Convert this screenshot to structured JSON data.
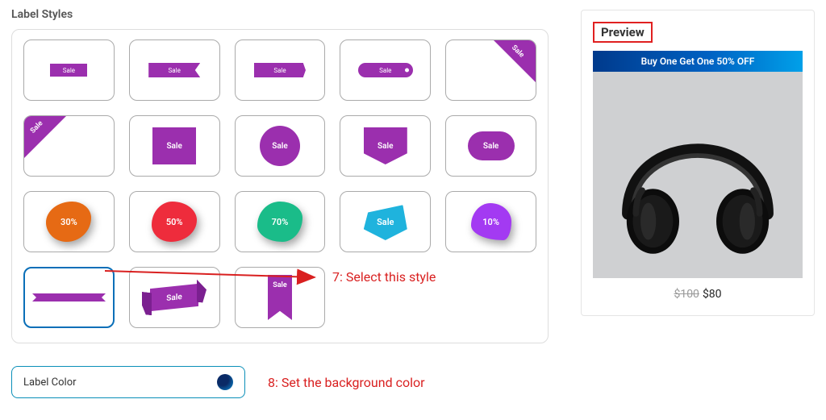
{
  "section_title": "Label Styles",
  "sale_text": "Sale",
  "blob_labels": {
    "b1": "30%",
    "b2": "50%",
    "b3": "70%",
    "b4": "Sale",
    "b5": "10%"
  },
  "annotations": {
    "step7": "7: Select this style",
    "step8": "8: Set the background color"
  },
  "color_field_label": "Label Color",
  "preview": {
    "title": "Preview",
    "promo": "Buy One Get One 50% OFF",
    "old_price": "$100",
    "new_price": "$80"
  },
  "colors": {
    "brand_purple": "#9b2fae",
    "annotation_red": "#d92020"
  }
}
